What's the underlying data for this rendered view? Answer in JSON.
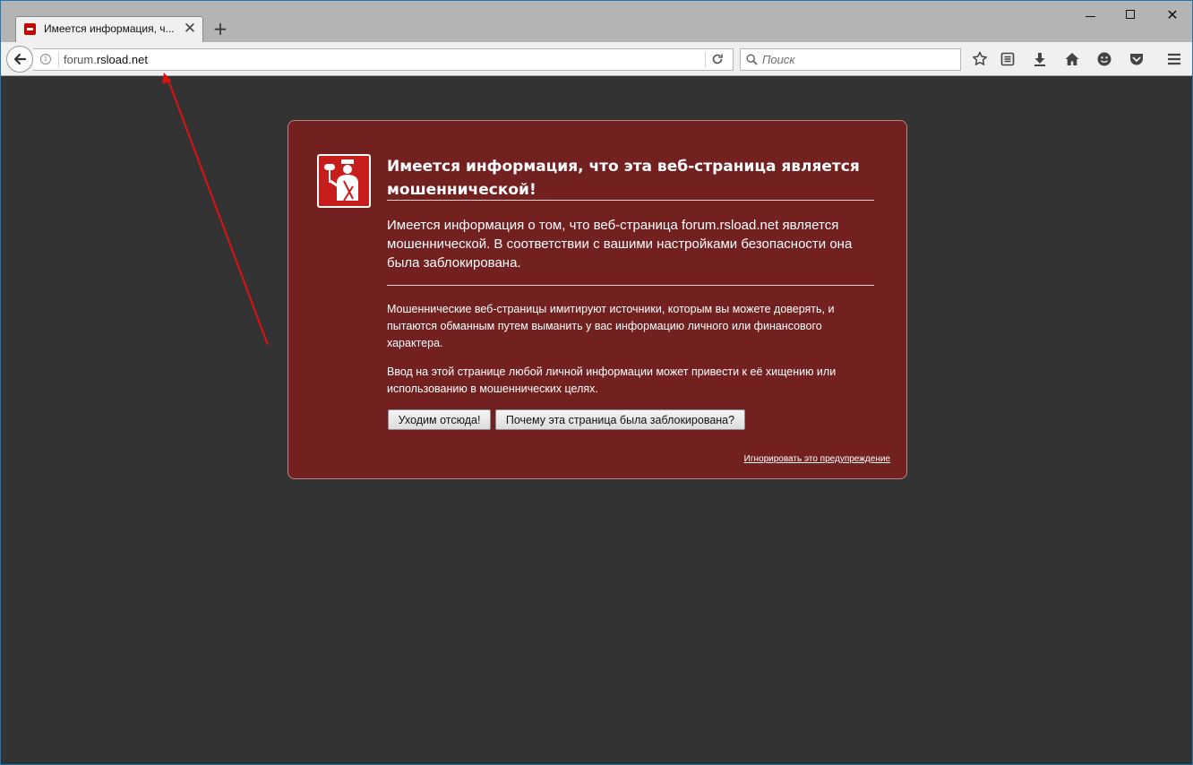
{
  "tab": {
    "title": "Имеется информация, ч...",
    "close_glyph": "✕",
    "new_tab_glyph": "+"
  },
  "window_controls": {
    "close_glyph": "✕"
  },
  "navbar": {
    "url_prefix": "forum.",
    "url_domain": "rsload.net",
    "info_glyph": "i",
    "search_placeholder": "Поиск"
  },
  "error": {
    "title": "Имеется информация, что эта веб-страница является мошеннической!",
    "short_desc": "Имеется информация о том, что веб-страница forum.rsload.net является мошеннической. В соответствии с вашими настройками безопасности она была заблокирована.",
    "long_desc_1": "Мошеннические веб-страницы имитируют источники, которым вы можете доверять, и пытаются обманным путем выманить у вас информацию личного или финансового характера.",
    "long_desc_2": "Ввод на этой странице любой личной информации может привести к её хищению или использованию в мошеннических целях.",
    "leave_button": "Уходим отсюда!",
    "why_button": "Почему эта страница была заблокирована?",
    "ignore_link": "Игнорировать это предупреждение"
  },
  "colors": {
    "error_background": "#722020",
    "page_background": "#333333",
    "annotation_arrow": "#e01010"
  },
  "icons": {
    "toolbar": [
      "bookmark-star-icon",
      "reading-list-icon",
      "downloads-icon",
      "home-icon",
      "hello-icon",
      "pocket-icon",
      "menu-icon"
    ],
    "error": "deceptive-site-icon"
  }
}
